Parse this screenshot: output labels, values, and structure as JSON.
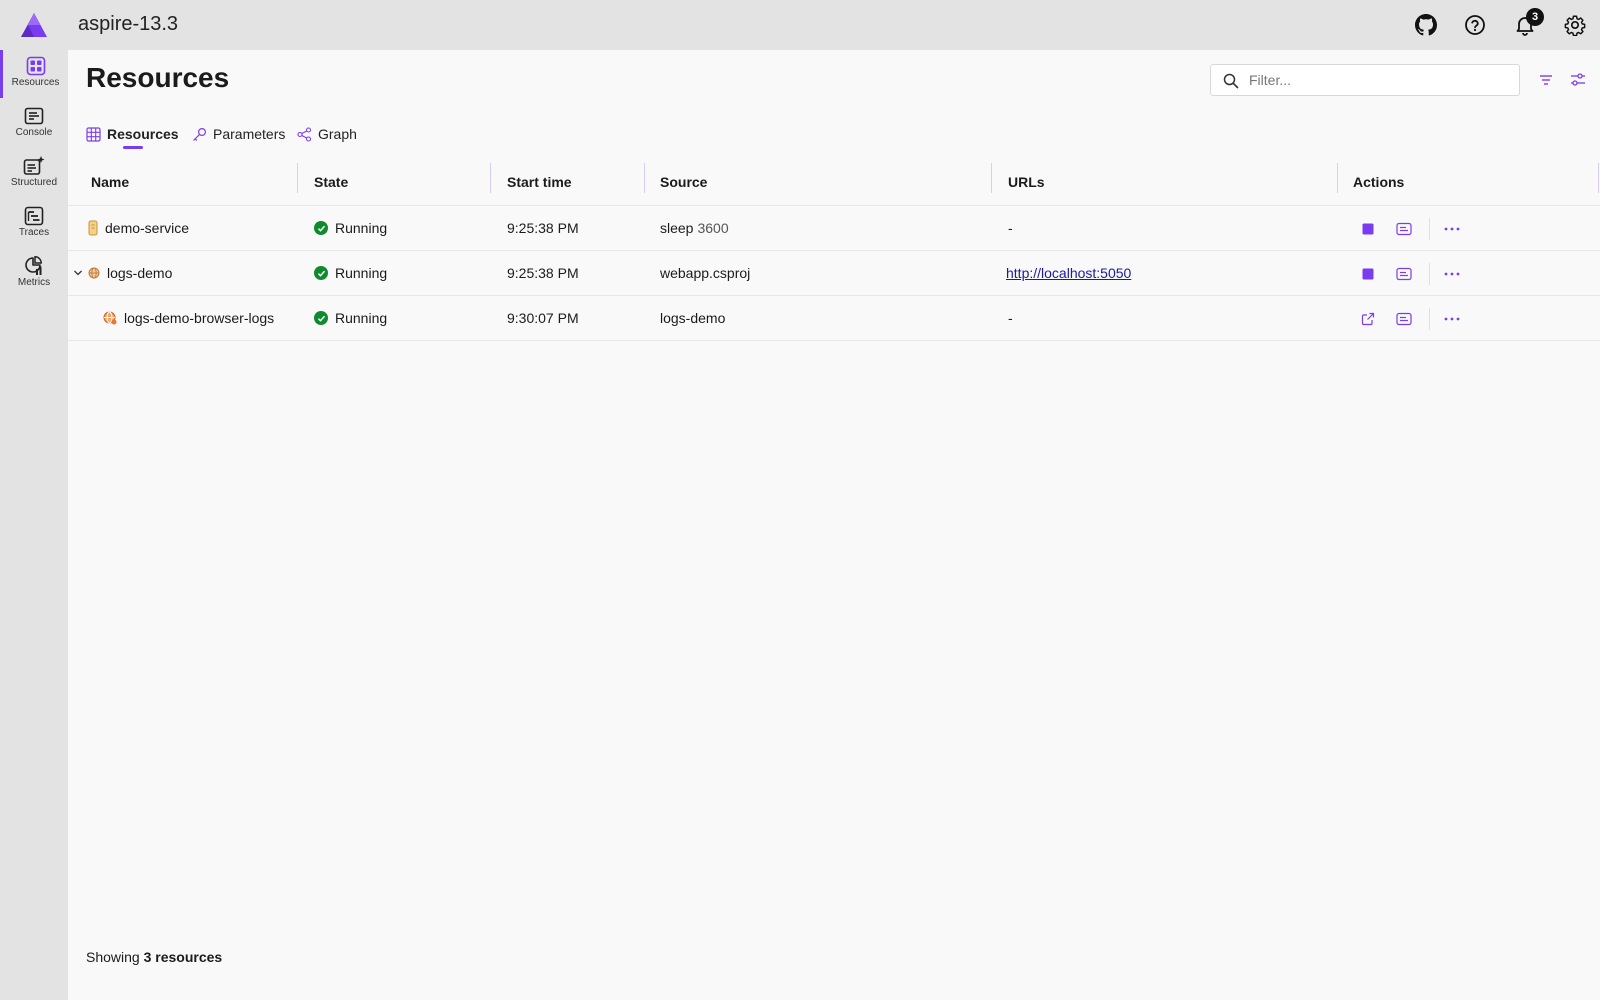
{
  "header": {
    "app_title": "aspire-13.3",
    "notification_count": "3"
  },
  "sidebar": {
    "items": [
      {
        "label": "Resources",
        "icon": "resources-icon"
      },
      {
        "label": "Console",
        "icon": "console-icon"
      },
      {
        "label": "Structured",
        "icon": "structured-icon"
      },
      {
        "label": "Traces",
        "icon": "traces-icon"
      },
      {
        "label": "Metrics",
        "icon": "metrics-icon"
      }
    ]
  },
  "main": {
    "page_title": "Resources",
    "filter_placeholder": "Filter...",
    "tabs": [
      {
        "label": "Resources",
        "icon": "grid-icon"
      },
      {
        "label": "Parameters",
        "icon": "key-icon"
      },
      {
        "label": "Graph",
        "icon": "share-icon"
      }
    ],
    "columns": [
      "Name",
      "State",
      "Start time",
      "Source",
      "URLs",
      "Actions"
    ],
    "rows": [
      {
        "name": "demo-service",
        "state": "Running",
        "start_time": "9:25:38 PM",
        "source": "sleep",
        "source_args": "3600",
        "url": "-"
      },
      {
        "name": "logs-demo",
        "state": "Running",
        "start_time": "9:25:38 PM",
        "source": "webapp.csproj",
        "source_args": "",
        "url": "http://localhost:5050"
      },
      {
        "name": "logs-demo-browser-logs",
        "state": "Running",
        "start_time": "9:30:07 PM",
        "source": "logs-demo",
        "source_args": "",
        "url": "-"
      }
    ],
    "footer_prefix": "Showing",
    "footer_count": "3 resources"
  },
  "colors": {
    "accent": "#7a3cf0",
    "running": "#0f8a2f",
    "chrome": "#e3e3e3"
  }
}
